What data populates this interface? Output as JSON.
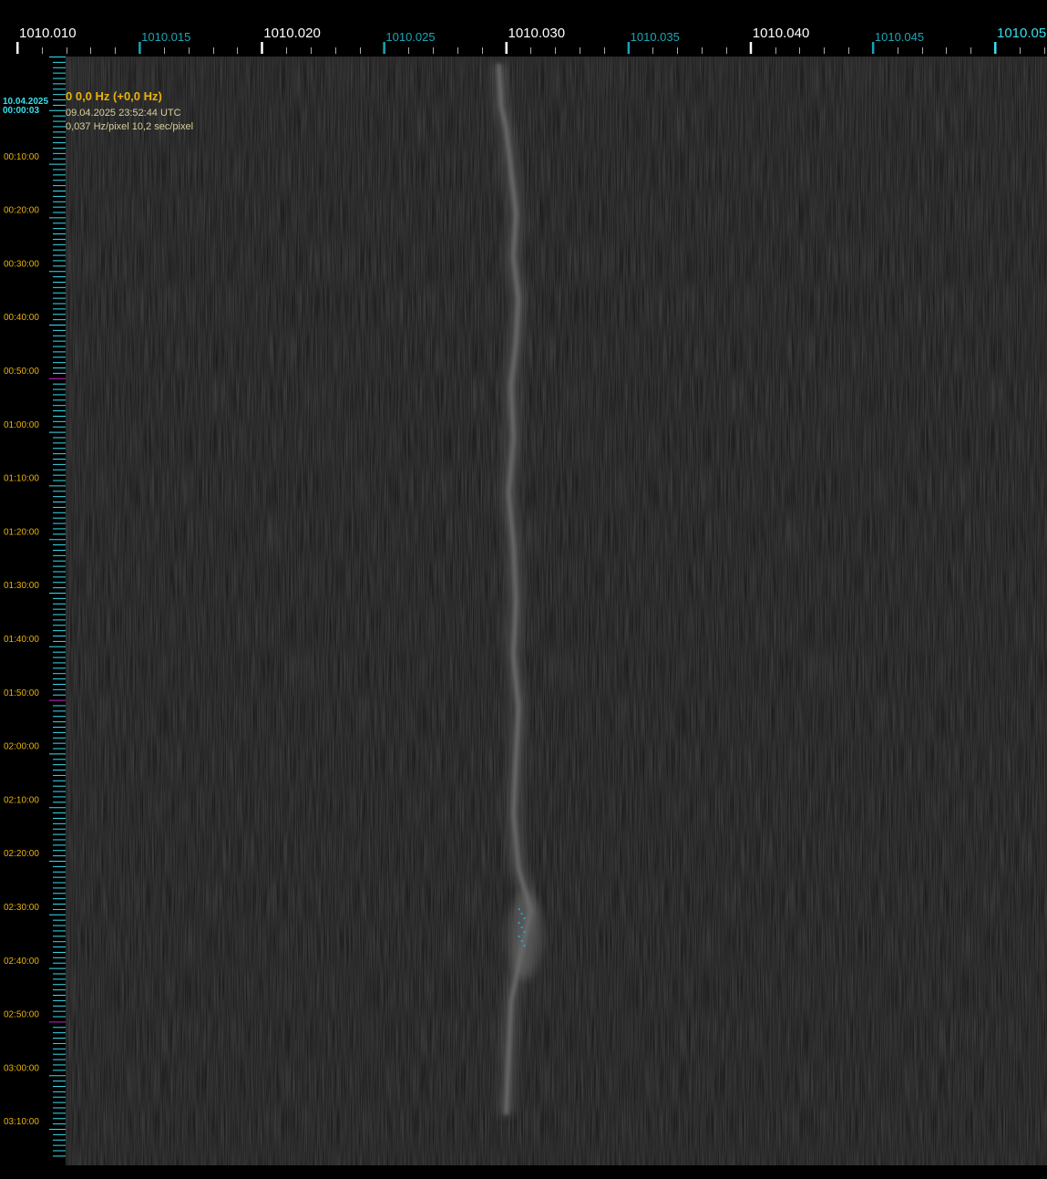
{
  "header": {
    "date": "10.04.2025",
    "start_time": "00:00:03"
  },
  "info": {
    "title": "0 0,0 Hz (+0,0 Hz)",
    "timestamp": "09.04.2025 23:52:44 UTC",
    "resolution": "0,037 Hz/pixel 10,2 sec/pixel"
  },
  "colors": {
    "major_tick_label": "#ffffff",
    "minor_tick_label": "#1aa6b6",
    "time_label": "#e8b20a",
    "time_tick": "#35e0ef",
    "hour_marker": "#d020d0",
    "background": "#111111"
  },
  "chart_data": {
    "type": "heatmap",
    "title": "",
    "xlabel": "",
    "ylabel": "",
    "x_range": [
      1010.01,
      1010.052
    ],
    "y_range_seconds": [
      0,
      11800
    ],
    "freq_ticks": [
      {
        "label": "1010.010",
        "major": true,
        "value": 1010.01
      },
      {
        "label": "1010.015",
        "major": false,
        "value": 1010.015
      },
      {
        "label": "1010.020",
        "major": true,
        "value": 1010.02
      },
      {
        "label": "1010.025",
        "major": false,
        "value": 1010.025
      },
      {
        "label": "1010.030",
        "major": true,
        "value": 1010.03
      },
      {
        "label": "1010.035",
        "major": false,
        "value": 1010.035
      },
      {
        "label": "1010.040",
        "major": true,
        "value": 1010.04
      },
      {
        "label": "1010.045",
        "major": false,
        "value": 1010.045
      },
      {
        "label": "1010.05",
        "major": true,
        "value": 1010.05
      }
    ],
    "time_ticks": [
      "00:10:00",
      "00:20:00",
      "00:30:00",
      "00:40:00",
      "00:50:00",
      "01:00:00",
      "01:10:00",
      "01:20:00",
      "01:30:00",
      "01:40:00",
      "01:50:00",
      "02:00:00",
      "02:10:00",
      "02:20:00",
      "02:30:00",
      "02:40:00",
      "02:50:00",
      "03:00:00",
      "03:10:00"
    ],
    "signal_trace": [
      {
        "t_min": 0,
        "freq": 1010.0297
      },
      {
        "t_min": 8,
        "freq": 1010.0298
      },
      {
        "t_min": 12,
        "freq": 1010.03
      },
      {
        "t_min": 20,
        "freq": 1010.0302
      },
      {
        "t_min": 28,
        "freq": 1010.0304
      },
      {
        "t_min": 36,
        "freq": 1010.0303
      },
      {
        "t_min": 44,
        "freq": 1010.0305
      },
      {
        "t_min": 52,
        "freq": 1010.0304
      },
      {
        "t_min": 60,
        "freq": 1010.0302
      },
      {
        "t_min": 70,
        "freq": 1010.0303
      },
      {
        "t_min": 80,
        "freq": 1010.0301
      },
      {
        "t_min": 90,
        "freq": 1010.0303
      },
      {
        "t_min": 100,
        "freq": 1010.0304
      },
      {
        "t_min": 110,
        "freq": 1010.0303
      },
      {
        "t_min": 120,
        "freq": 1010.0305
      },
      {
        "t_min": 130,
        "freq": 1010.0304
      },
      {
        "t_min": 140,
        "freq": 1010.0303
      },
      {
        "t_min": 150,
        "freq": 1010.0305
      },
      {
        "t_min": 158,
        "freq": 1010.031
      },
      {
        "t_min": 166,
        "freq": 1010.0306
      },
      {
        "t_min": 175,
        "freq": 1010.0302
      },
      {
        "t_min": 185,
        "freq": 1010.0301
      },
      {
        "t_min": 196,
        "freq": 1010.03
      }
    ]
  }
}
